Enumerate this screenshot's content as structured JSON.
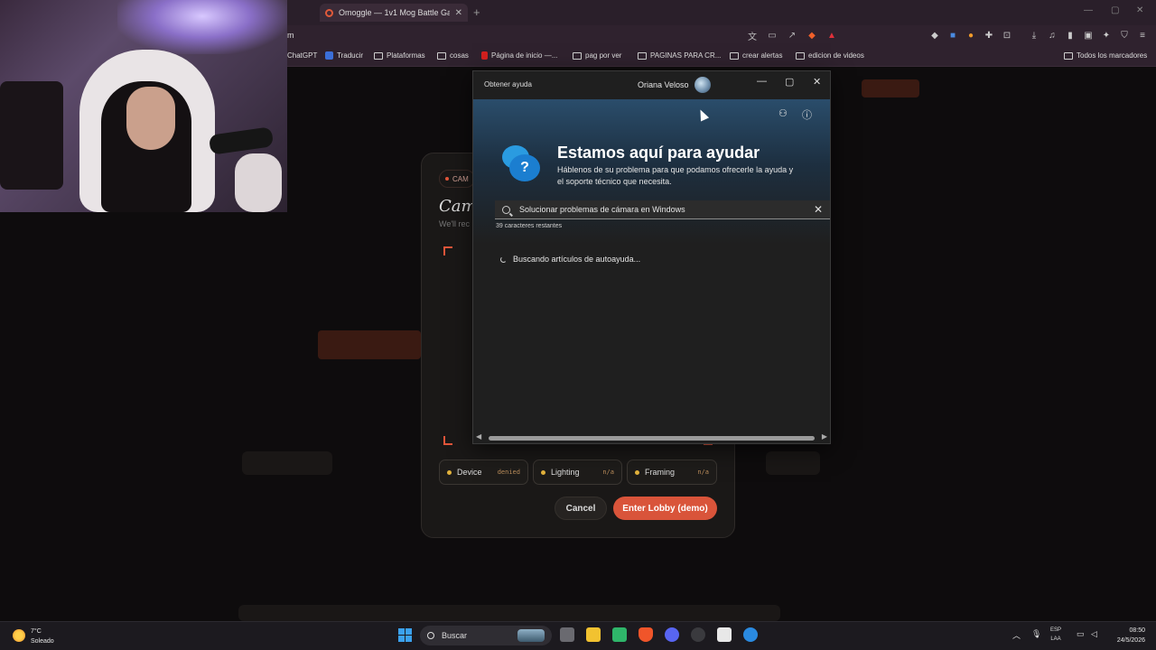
{
  "browser": {
    "tab_title": "Omoggle — 1v1 Mog Battle Ga",
    "tab_close": "✕",
    "new_tab": "+",
    "url": "m",
    "bookmarks": [
      "ChatGPT",
      "Traducir",
      "Plataformas",
      "cosas",
      "Página de inicio —...",
      "pag por ver",
      "PAGINAS PARA CR...",
      "crear alertas",
      "edicion de videos"
    ],
    "all_bookmarks": "Todos los marcadores"
  },
  "camera_modal": {
    "pill": "CAM",
    "title": "Came",
    "subtitle": "We'll rec",
    "statuses": [
      {
        "label": "Device",
        "value": "denied"
      },
      {
        "label": "Lighting",
        "value": "n/a"
      },
      {
        "label": "Framing",
        "value": "n/a"
      }
    ],
    "cancel": "Cancel",
    "enter": "Enter Lobby (demo)"
  },
  "help_window": {
    "app_name": "Obtener ayuda",
    "user_name": "Oriana Veloso",
    "heading": "Estamos aquí para ayudar",
    "description": "Háblenos de su problema para que podamos ofrecerle la ayuda y el soporte técnico que necesita.",
    "search_value": "Solucionar problemas de cámara en Windows",
    "chars_remaining": "39 caracteres restantes",
    "loading": "Buscando artículos de autoayuda...",
    "bubble_glyph": "?"
  },
  "taskbar": {
    "temp": "7°C",
    "weather": "Soleado",
    "search": "Buscar",
    "lang_top": "ESP",
    "lang_bottom": "LAA",
    "time": "08:50",
    "date": "24/5/2026"
  }
}
